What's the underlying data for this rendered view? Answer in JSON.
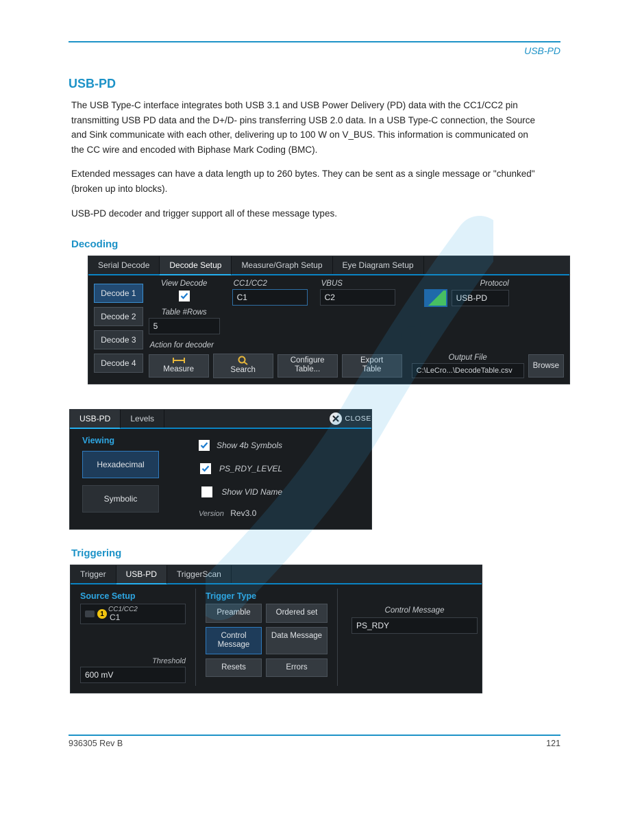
{
  "header": {
    "right_text": "USB-PD"
  },
  "intro": {
    "title": "USB-PD",
    "p1": "The USB Type-C interface integrates both USB 3.1 and USB Power Delivery (PD) data with the CC1/CC2 pin transmitting USB PD data and the D+/D- pins transferring USB 2.0 data. In a USB Type-C connection, the Source and Sink communicate with each other, delivering up to 100 W on V_BUS. This information is communicated on the CC wire and encoded with Biphase Mark Coding (BMC).",
    "p2": "Extended messages can have a data length up to 260 bytes. They can be sent as a single message or \"chunked\" (broken up into blocks).",
    "p3": "USB-PD decoder and trigger support all of these message types."
  },
  "decode_section": {
    "title": "Decoding",
    "panel": {
      "tabs": [
        "Serial Decode",
        "Decode Setup",
        "Measure/Graph Setup",
        "Eye Diagram Setup"
      ],
      "active_tab": "Decode Setup",
      "decodes": [
        "Decode 1",
        "Decode 2",
        "Decode 3",
        "Decode 4"
      ],
      "selected_decode": "Decode 1",
      "view_decode_label": "View Decode",
      "view_decode_checked": true,
      "table_rows_label": "Table #Rows",
      "table_rows_value": "5",
      "cc_label": "CC1/CC2",
      "cc_value": "C1",
      "vbus_label": "VBUS",
      "vbus_value": "C2",
      "protocol_label": "Protocol",
      "protocol_value": "USB-PD",
      "action_label": "Action for decoder",
      "actions": {
        "measure": "Measure",
        "search": "Search",
        "configure_table": "Configure\nTable...",
        "export_table": "Export\nTable"
      },
      "output_file_label": "Output File",
      "output_file_value": "C:\\LeCro...\\DecodeTable.csv",
      "browse_label": "Browse"
    },
    "dialog": {
      "tabs": [
        "USB-PD",
        "Levels"
      ],
      "active_tab": "USB-PD",
      "close_label": "CLOSE",
      "viewing_label": "Viewing",
      "view_modes": {
        "hex": "Hexadecimal",
        "sym": "Symbolic"
      },
      "selected_mode": "Hexadecimal",
      "opts": {
        "show4b": {
          "label": "Show 4b Symbols",
          "checked": true
        },
        "psrdy": {
          "label": "PS_RDY_LEVEL",
          "checked": true
        },
        "vid": {
          "label": "Show VID Name",
          "checked": false
        }
      },
      "version_label": "Version",
      "version_value": "Rev3.0"
    }
  },
  "trigger_section": {
    "title": "Triggering",
    "tabs": [
      "Trigger",
      "USB-PD",
      "TriggerScan"
    ],
    "active_tab": "USB-PD",
    "source": {
      "title": "Source Setup",
      "cc_label": "CC1/CC2",
      "cc_badge": "1",
      "cc_value": "C1",
      "threshold_label": "Threshold",
      "threshold_value": "600 mV"
    },
    "trigger_type": {
      "title": "Trigger Type",
      "buttons": {
        "preamble": "Preamble",
        "ordered": "Ordered set",
        "control": "Control\nMessage",
        "data": "Data Message",
        "resets": "Resets",
        "errors": "Errors"
      },
      "selected": "Control\nMessage"
    },
    "control_message": {
      "label": "Control Message",
      "value": "PS_RDY"
    }
  },
  "footer": {
    "left": "936305 Rev B",
    "right": "121"
  }
}
